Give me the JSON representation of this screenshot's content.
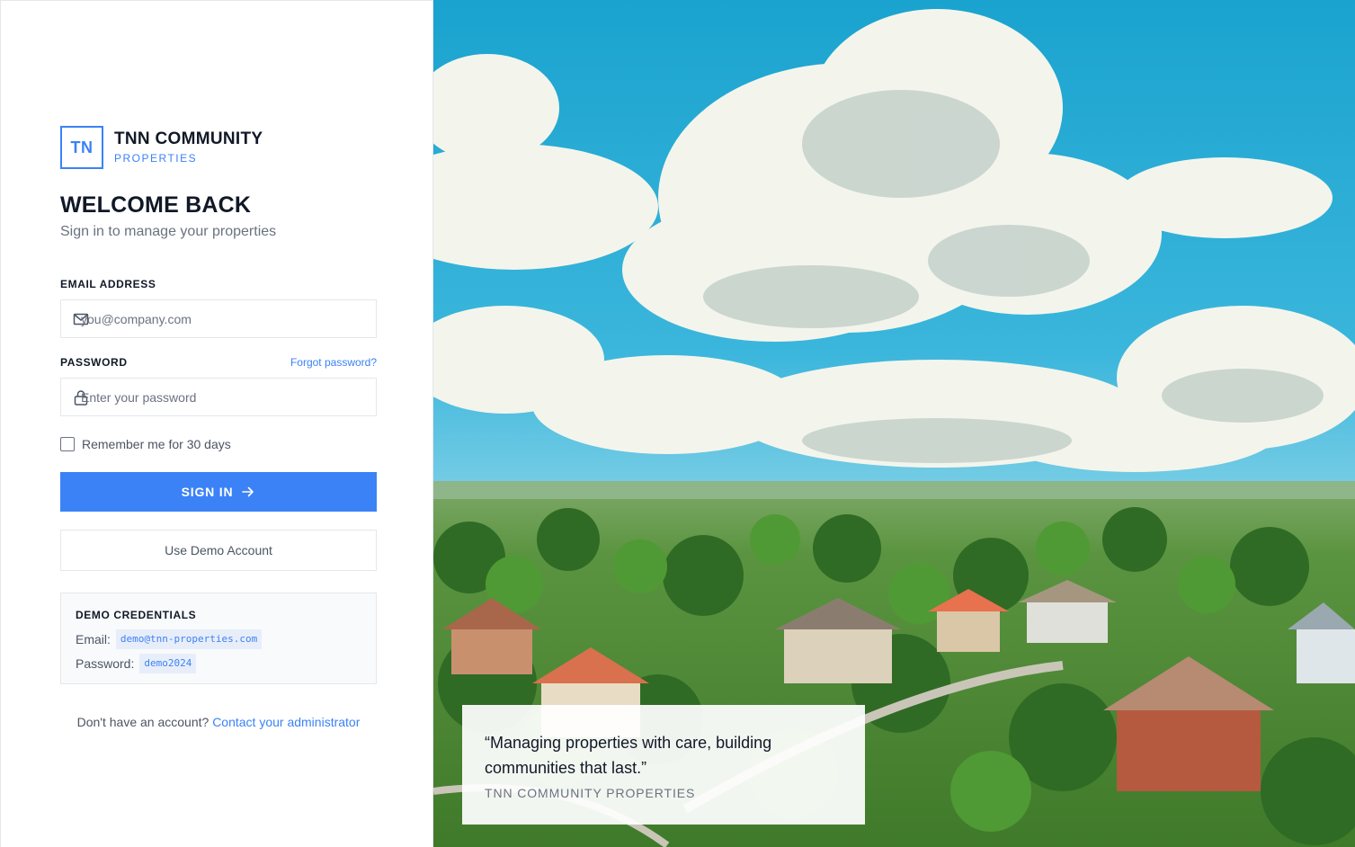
{
  "brand": {
    "logo_initials": "TN",
    "title": "TNN COMMUNITY",
    "subtitle": "PROPERTIES"
  },
  "header": {
    "title": "WELCOME BACK",
    "subtitle": "Sign in to manage your properties"
  },
  "form": {
    "email_label": "EMAIL ADDRESS",
    "email_placeholder": "you@company.com",
    "email_icon": "mail-icon",
    "password_label": "PASSWORD",
    "password_placeholder": "Enter your password",
    "password_icon": "lock-icon",
    "forgot_label": "Forgot password?",
    "remember_label": "Remember me for 30 days",
    "remember_checked": false,
    "signin_label": "SIGN IN",
    "signin_icon": "arrow-right-icon",
    "demo_label": "Use Demo Account"
  },
  "demo_credentials": {
    "title": "DEMO CREDENTIALS",
    "email_label": "Email:",
    "email_value": "demo@tnn-properties.com",
    "password_label": "Password:",
    "password_value": "demo2024"
  },
  "footer": {
    "prompt": "Don't have an account?",
    "link": "Contact your administrator"
  },
  "quote": {
    "text": "“Managing properties with care, building communities that last.”",
    "author": "TNN COMMUNITY PROPERTIES"
  },
  "colors": {
    "accent": "#3b82f6",
    "text_primary": "#111827",
    "text_secondary": "#6b7280",
    "border": "#e5e7eb"
  }
}
